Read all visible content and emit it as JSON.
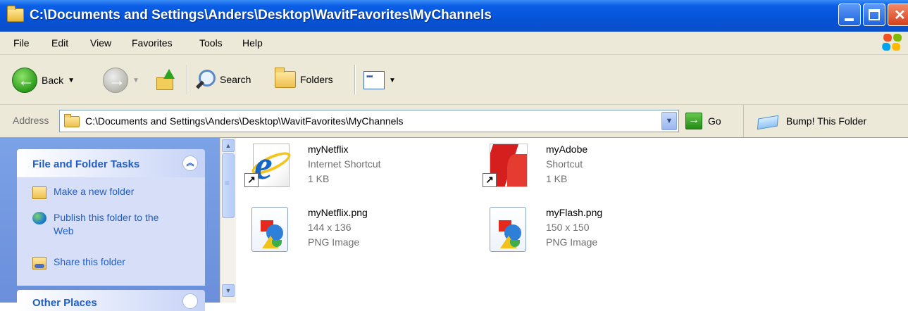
{
  "window": {
    "title": "C:\\Documents and Settings\\Anders\\Desktop\\WavitFavorites\\MyChannels"
  },
  "menubar": {
    "items": [
      "File",
      "Edit",
      "View",
      "Favorites",
      "Tools",
      "Help"
    ]
  },
  "toolbar": {
    "back_label": "Back",
    "search_label": "Search",
    "folders_label": "Folders"
  },
  "address": {
    "label": "Address",
    "value": "C:\\Documents and Settings\\Anders\\Desktop\\WavitFavorites\\MyChannels",
    "go_label": "Go",
    "bump_label": "Bump! This Folder"
  },
  "taskpane": {
    "file_folder_tasks": {
      "title": "File and Folder Tasks",
      "items": [
        {
          "label": "Make a new folder",
          "icon": "new-folder-icon"
        },
        {
          "label": "Publish this folder to the Web",
          "icon": "globe-icon"
        },
        {
          "label": "Share this folder",
          "icon": "share-folder-icon"
        }
      ]
    },
    "other_places": {
      "title": "Other Places"
    }
  },
  "files": [
    {
      "name": "myNetflix",
      "type": "Internet Shortcut",
      "detail": "1 KB",
      "icon": "internet-explorer-icon"
    },
    {
      "name": "myAdobe",
      "type": "Shortcut",
      "detail": "1 KB",
      "icon": "adobe-acrobat-icon"
    },
    {
      "name": "myNetflix.png",
      "type": "144 x 136",
      "detail": "PNG Image",
      "icon": "png-image-icon"
    },
    {
      "name": "myFlash.png",
      "type": "150 x 150",
      "detail": "PNG Image",
      "icon": "png-image-icon"
    }
  ]
}
